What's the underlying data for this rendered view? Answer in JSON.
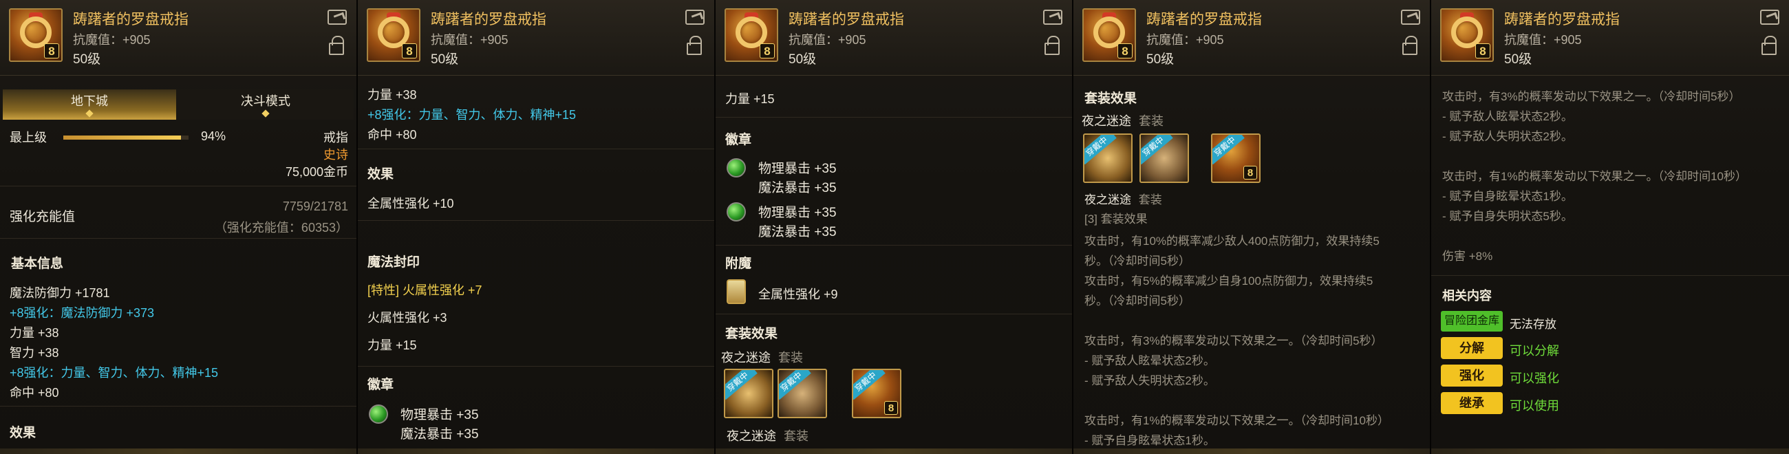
{
  "item": {
    "title": "踌躇者的罗盘戒指",
    "resist": "抗魔值：+905",
    "level": "50级",
    "upgrade_badge": "8"
  },
  "p1": {
    "tabs": [
      "地下城",
      "决斗模式"
    ],
    "grade_label": "最上级",
    "grade_percent": 94,
    "grade_percent_text": "94%",
    "slot": "戒指",
    "rarity": "史诗",
    "price": "75,000金币",
    "reinforce_label": "强化充能值",
    "reinforce_value": "7759/21781",
    "reinforce_note": "（强化充能值：60353）",
    "basic_info": "基本信息",
    "lines": [
      "魔法防御力 +1781",
      "+8强化：魔法防御力 +373",
      "力量 +38",
      "智力 +38",
      "+8强化：力量、智力、体力、精神+15",
      "命中 +80"
    ],
    "effect": "效果"
  },
  "p2": {
    "top_partial": "力量 +38",
    "lines": [
      "智力 +38",
      "+8强化：力量、智力、体力、精神+15",
      "命中 +80"
    ],
    "effect_head": "效果",
    "effect_line": "全属性强化 +10",
    "seal_head": "魔法封印",
    "seal_trait": "[特性] 火属性强化 +7",
    "seal_line1": "火属性强化 +3",
    "seal_line2": "力量 +15",
    "emblem_head": "徽章",
    "emblem_lines": [
      "物理暴击 +35",
      "魔法暴击 +35"
    ]
  },
  "p3": {
    "top_line": "力量 +15",
    "emblem_head": "徽章",
    "emblem1": [
      "物理暴击 +35",
      "魔法暴击 +35"
    ],
    "emblem2": [
      "物理暴击 +35",
      "魔法暴击 +35"
    ],
    "enchant_head": "附魔",
    "enchant_line": "全属性强化 +9",
    "set_head": "套装效果",
    "set_name": "夜之迷途",
    "set_suffix": "套装",
    "set_bottom_name": "夜之迷途",
    "set_bottom_suffix": "套装",
    "set_badge": "穿戴中"
  },
  "p4": {
    "set_head": "套装效果",
    "set_name": "夜之迷途",
    "set_suffix": "套装",
    "set_sub_name": "夜之迷途",
    "set_sub_suffix": "套装",
    "set_count": "[3] 套装效果",
    "desc": [
      "攻击时，有10%的概率减少敌人400点防御力，效果持续5",
      "秒。（冷却时间5秒）",
      "攻击时，有5%的概率减少自身100点防御力，效果持续5",
      "秒。（冷却时间5秒）",
      "",
      "攻击时，有3%的概率发动以下效果之一。（冷却时间5秒）",
      "- 赋予敌人眩晕状态2秒。",
      "- 赋予敌人失明状态2秒。",
      "",
      "攻击时，有1%的概率发动以下效果之一。（冷却时间10秒）",
      "- 赋予自身眩晕状态1秒。"
    ],
    "set_badge": "穿戴中"
  },
  "p5": {
    "desc": [
      "攻击时，有3%的概率发动以下效果之一。（冷却时间5秒）",
      "- 赋予敌人眩晕状态2秒。",
      "- 赋予敌人失明状态2秒。",
      "",
      "攻击时，有1%的概率发动以下效果之一。（冷却时间10秒）",
      "- 赋予自身眩晕状态1秒。",
      "- 赋予自身失明状态5秒。",
      "",
      "伤害 +8%"
    ],
    "related_head": "相关内容",
    "vault_tag": "冒险团金库",
    "vault_text": "无法存放",
    "actions": [
      {
        "label": "分解",
        "status": "可以分解"
      },
      {
        "label": "强化",
        "status": "可以强化"
      },
      {
        "label": "继承",
        "status": "可以使用"
      }
    ]
  }
}
